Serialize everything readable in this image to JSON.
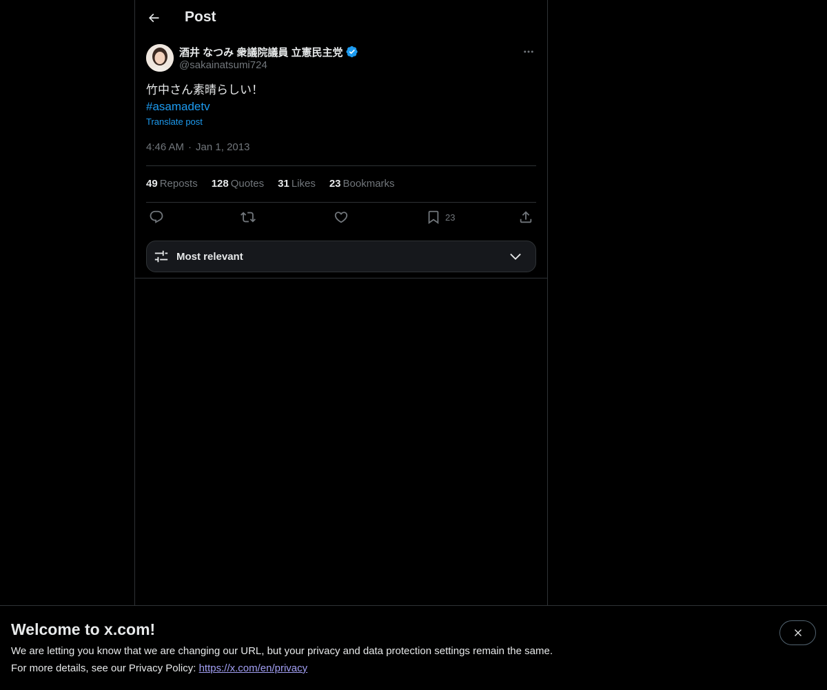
{
  "header": {
    "title": "Post"
  },
  "post": {
    "author_name": "酒井 なつみ 衆議院議員 立憲民主党",
    "author_handle": "@sakainatsumi724",
    "verified": true,
    "text": "竹中さん素晴らしい！",
    "hashtag": "#asamadetv",
    "translate_label": "Translate post",
    "time": "4:46 AM",
    "date": "Jan 1, 2013",
    "stats": [
      {
        "count": "49",
        "label": "Reposts"
      },
      {
        "count": "128",
        "label": "Quotes"
      },
      {
        "count": "31",
        "label": "Likes"
      },
      {
        "count": "23",
        "label": "Bookmarks"
      }
    ],
    "bookmark_count": "23"
  },
  "sort": {
    "label": "Most relevant"
  },
  "banner": {
    "title": "Welcome to x.com!",
    "line1": "We are letting you know that we are changing our URL, but your privacy and data protection settings remain the same.",
    "line2_prefix": "For more details, see our Privacy Policy: ",
    "link": "https://x.com/en/privacy"
  },
  "colors": {
    "accent": "#1d9bf0",
    "background": "#000000",
    "border": "#2f3336",
    "muted_text": "#71767b"
  },
  "icons": [
    "back-arrow-icon",
    "verified-badge-icon",
    "more-dots-icon",
    "reply-icon",
    "repost-icon",
    "like-icon",
    "bookmark-icon",
    "share-icon",
    "sliders-icon",
    "chevron-down-icon",
    "close-icon"
  ]
}
